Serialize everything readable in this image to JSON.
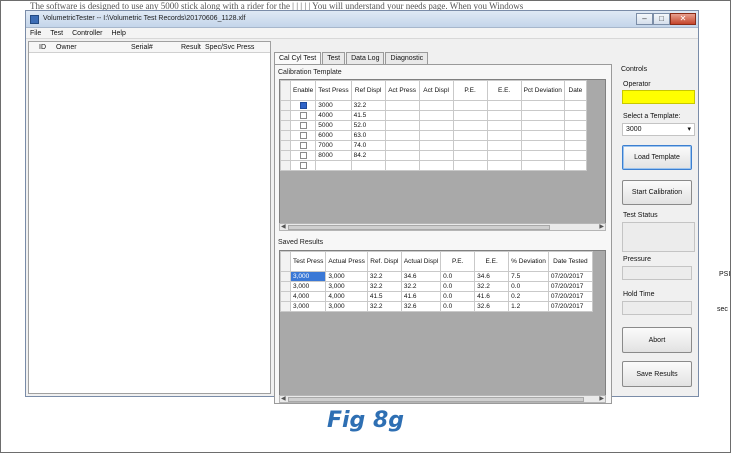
{
  "background_text": "The software is designed to use any 5000 stick along with a rider for the  |  |  |  |  |   You will understand your needs page. When you Windows",
  "window": {
    "title": "VolumetricTester -- I:\\Volumetric Test Records\\20170606_1128.xlf",
    "buttons": [
      "–",
      "□",
      "✕"
    ]
  },
  "menu": [
    "File",
    "Test",
    "Controller",
    "Help"
  ],
  "left_list": {
    "columns": [
      "ID",
      "Owner",
      "Serial#",
      "Result",
      "Spec/Svc Press"
    ]
  },
  "tabs": [
    "Cal Cyl Test",
    "Test",
    "Data Log",
    "Diagnostic"
  ],
  "calibration": {
    "label": "Calibration Template",
    "columns": [
      "Enable",
      "Test Press",
      "Ref Displ",
      "Act Press",
      "Act Displ",
      "P.E.",
      "E.E.",
      "Pct Deviation",
      "Date"
    ],
    "rows": [
      {
        "checked": true,
        "press": "3000",
        "ref": "32.2"
      },
      {
        "checked": false,
        "press": "4000",
        "ref": "41.5"
      },
      {
        "checked": false,
        "press": "5000",
        "ref": "52.0"
      },
      {
        "checked": false,
        "press": "6000",
        "ref": "63.0"
      },
      {
        "checked": false,
        "press": "7000",
        "ref": "74.0"
      },
      {
        "checked": false,
        "press": "8000",
        "ref": "84.2"
      },
      {
        "checked": false,
        "press": "",
        "ref": ""
      }
    ]
  },
  "saved": {
    "label": "Saved Results",
    "columns": [
      "Test Press",
      "Actual Press",
      "Ref. Displ",
      "Actual Displ",
      "P.E.",
      "E.E.",
      "% Deviation",
      "Date Tested"
    ],
    "rows": [
      [
        "3,000",
        "3,000",
        "32.2",
        "34.6",
        "0.0",
        "34.6",
        "7.5",
        "07/20/2017"
      ],
      [
        "3,000",
        "3,000",
        "32.2",
        "32.2",
        "0.0",
        "32.2",
        "0.0",
        "07/20/2017"
      ],
      [
        "4,000",
        "4,000",
        "41.5",
        "41.6",
        "0.0",
        "41.6",
        "0.2",
        "07/20/2017"
      ],
      [
        "3,000",
        "3,000",
        "32.2",
        "32.6",
        "0.0",
        "32.6",
        "1.2",
        "07/20/2017"
      ]
    ]
  },
  "controls": {
    "header": "Controls",
    "operator_label": "Operator",
    "template_label": "Select a Template:",
    "template_value": "3000",
    "load_button": "Load Template",
    "start_button": "Start Calibration",
    "status_label": "Test Status",
    "pressure_label": "Pressure",
    "pressure_unit": "PSI",
    "hold_label": "Hold Time",
    "hold_unit": "sec",
    "abort_button": "Abort",
    "save_button": "Save Results"
  },
  "caption": "Fig 8g",
  "colors": {
    "operator_field": "#ffff00",
    "selected_cell": "#3a78d6",
    "caption": "#2e6fb3"
  }
}
